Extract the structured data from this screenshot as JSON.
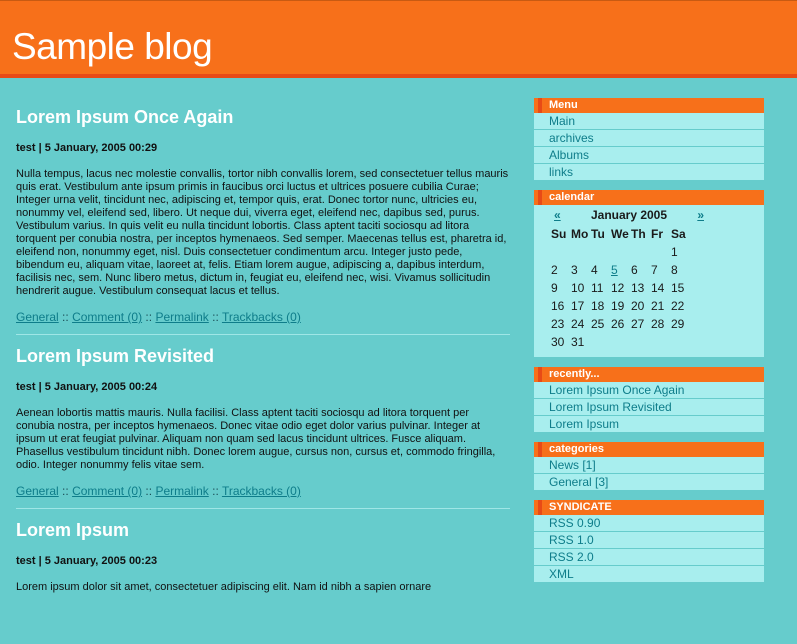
{
  "site": {
    "title": "Sample blog"
  },
  "posts": [
    {
      "title": "Lorem Ipsum Once Again",
      "meta": "test | 5 January, 2005 00:29",
      "body": "Nulla tempus, lacus nec molestie convallis, tortor nibh convallis lorem, sed consectetuer tellus mauris quis erat. Vestibulum ante ipsum primis in faucibus orci luctus et ultrices posuere cubilia Curae; Integer urna velit, tincidunt nec, adipiscing et, tempor quis, erat. Donec tortor nunc, ultricies eu, nonummy vel, eleifend sed, libero. Ut neque dui, viverra eget, eleifend nec, dapibus sed, purus. Vestibulum varius. In quis velit eu nulla tincidunt lobortis. Class aptent taciti sociosqu ad litora torquent per conubia nostra, per inceptos hymenaeos. Sed semper. Maecenas tellus est, pharetra id, eleifend non, nonummy eget, nisl. Duis consectetuer condimentum arcu. Integer justo pede, bibendum eu, aliquam vitae, laoreet at, felis. Etiam lorem augue, adipiscing a, dapibus interdum, facilisis nec, sem. Nunc libero metus, dictum in, feugiat eu, eleifend nec, wisi. Vivamus sollicitudin hendrerit augue. Vestibulum consequat lacus et tellus.",
      "links": {
        "category": "General",
        "comment": "Comment (0)",
        "permalink": "Permalink",
        "trackbacks": "Trackbacks (0)"
      }
    },
    {
      "title": "Lorem Ipsum Revisited",
      "meta": "test | 5 January, 2005 00:24",
      "body": "Aenean lobortis mattis mauris. Nulla facilisi. Class aptent taciti sociosqu ad litora torquent per conubia nostra, per inceptos hymenaeos. Donec vitae odio eget dolor varius pulvinar. Integer at ipsum ut erat feugiat pulvinar. Aliquam non quam sed lacus tincidunt ultrices. Fusce aliquam. Phasellus vestibulum tincidunt nibh. Donec lorem augue, cursus non, cursus et, commodo fringilla, odio. Integer nonummy felis vitae sem.",
      "links": {
        "category": "General",
        "comment": "Comment (0)",
        "permalink": "Permalink",
        "trackbacks": "Trackbacks (0)"
      }
    },
    {
      "title": "Lorem Ipsum",
      "meta": "test | 5 January, 2005 00:23",
      "body": "Lorem ipsum dolor sit amet, consectetuer adipiscing elit. Nam id nibh a sapien ornare"
    }
  ],
  "link_separator": "::",
  "sidebar": {
    "menu": {
      "title": "Menu",
      "items": [
        "Main",
        "archives",
        "Albums",
        "links"
      ]
    },
    "calendar": {
      "title": "calendar",
      "prev": "«",
      "next": "»",
      "month": "January 2005",
      "days": [
        "Su",
        "Mo",
        "Tu",
        "We",
        "Th",
        "Fr",
        "Sa"
      ],
      "weeks": [
        [
          "",
          "",
          "",
          "",
          "",
          "",
          "1"
        ],
        [
          "2",
          "3",
          "4",
          "5",
          "6",
          "7",
          "8"
        ],
        [
          "9",
          "10",
          "11",
          "12",
          "13",
          "14",
          "15"
        ],
        [
          "16",
          "17",
          "18",
          "19",
          "20",
          "21",
          "22"
        ],
        [
          "23",
          "24",
          "25",
          "26",
          "27",
          "28",
          "29"
        ],
        [
          "30",
          "31",
          "",
          "",
          "",
          "",
          ""
        ]
      ],
      "linked_day": "5"
    },
    "recently": {
      "title": "recently...",
      "items": [
        "Lorem Ipsum Once Again",
        "Lorem Ipsum Revisited",
        "Lorem Ipsum"
      ]
    },
    "categories": {
      "title": "categories",
      "items": [
        "News [1]",
        "General [3]"
      ]
    },
    "syndicate": {
      "title": "SYNDICATE",
      "items": [
        "RSS 0.90",
        "RSS 1.0",
        "RSS 2.0",
        "XML"
      ]
    }
  },
  "colors": {
    "background": "#66cccc",
    "accent": "#f7701a",
    "sidebar_box": "#a8eeee",
    "link": "#0e7d8a"
  }
}
